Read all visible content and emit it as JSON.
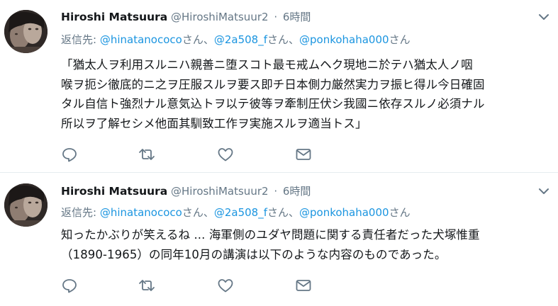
{
  "tweets": [
    {
      "author_name": "Hiroshi Matsuura",
      "author_handle": "@HiroshiMatsuur2",
      "separator": "·",
      "time": "6時間",
      "reply_prefix": "返信先: ",
      "reply_mentions": [
        "@hinatanococo",
        "@2a508_f",
        "@ponkohaha000"
      ],
      "reply_san": [
        "さん、",
        "さん、",
        "さん"
      ],
      "body_lines": [
        "「猶太人ヲ利用スルニハ親善ニ堕スコト最モ戒ムヘク現地ニ於テハ猶太人ノ咽",
        "喉ヲ扼シ徹底的ニ之ヲ圧服スルヲ要ス即チ日本側力厳然実力ヲ振ヒ得ル今日確固",
        "タル自信ト強烈ナル意気込トヲ以テ彼等ヲ牽制圧伏シ我國ニ依存スルノ必須ナル",
        "所以ヲ了解セシメ他面其馴致工作ヲ実施スルヲ適当トス」"
      ],
      "icons": [
        "reply-icon",
        "retweet-icon",
        "like-icon",
        "message-icon"
      ]
    },
    {
      "author_name": "Hiroshi Matsuura",
      "author_handle": "@HiroshiMatsuur2",
      "separator": "·",
      "time": "6時間",
      "reply_prefix": "返信先: ",
      "reply_mentions": [
        "@hinatanococo",
        "@2a508_f",
        "@ponkohaha000"
      ],
      "reply_san": [
        "さん、",
        "さん、",
        "さん"
      ],
      "body_lines": [
        "知ったかぶりが笑えるね ... 海軍側のユダヤ問題に関する責任者だった犬塚惟重",
        "（1890-1965）の同年10月の講演は以下のような内容のものであった。"
      ],
      "icons": [
        "reply-icon",
        "retweet-icon",
        "like-icon",
        "message-icon"
      ]
    }
  ],
  "colors": {
    "name": "#14171a",
    "meta": "#657786",
    "link": "#1b95e0",
    "divider": "#e6ecf0"
  }
}
